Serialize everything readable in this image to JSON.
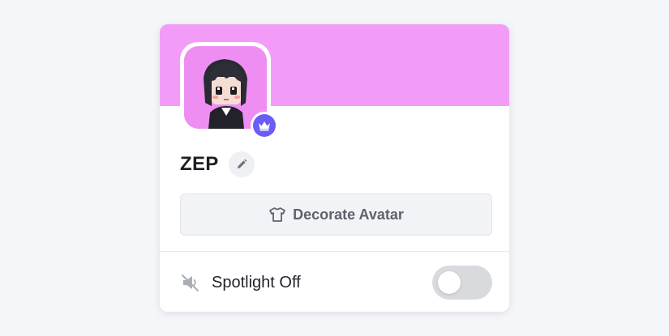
{
  "colors": {
    "banner": "#f29cf7",
    "avatar_bg": "#ef8ef2",
    "crown_badge": "#6a5cf6",
    "toggle_off": "#d8dade"
  },
  "profile": {
    "name": "ZEP",
    "avatar_icon": "pixel-avatar",
    "badge_icon": "crown-icon",
    "edit_icon": "pencil-icon"
  },
  "decorate": {
    "icon": "shirt-icon",
    "label": "Decorate Avatar"
  },
  "spotlight": {
    "icon": "spotlight-off-icon",
    "label": "Spotlight Off",
    "enabled": false
  }
}
